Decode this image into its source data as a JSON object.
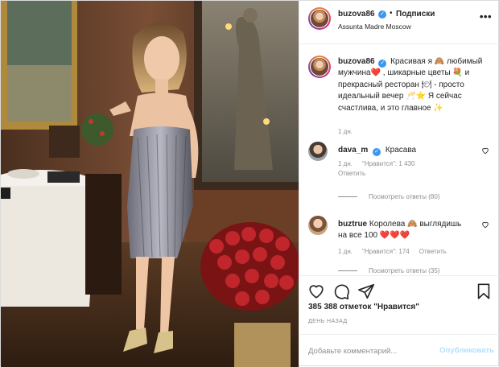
{
  "header": {
    "username": "buzova86",
    "separator": "•",
    "follow_label": "Подписки",
    "location": "Assunta Madre Moscow",
    "more": "•••"
  },
  "caption": {
    "username": "buzova86",
    "text": "Красивая я 🙈 любимый мужчина❤️ , шикарные цветы 💐 и прекрасный ресторан 🍽 - просто идеальный вечер 🥂⭐ Я сейчас счастлива, и это главное ✨",
    "time": "1 дн."
  },
  "comments": [
    {
      "username": "dava_m",
      "text": "Красава",
      "time": "1 дн.",
      "likes": "\"Нравится\": 1 430",
      "reply": "Ответить",
      "view_replies": "Посмотреть ответы (80)"
    },
    {
      "username": "buztrue",
      "text": "Королева 🙈 выглядишь на все 100 ❤️❤️❤️",
      "time": "1 дн.",
      "likes": "\"Нравится\": 174",
      "reply": "Ответить",
      "view_replies": "Посмотреть ответы (35)"
    }
  ],
  "likes": {
    "count_text": "385 388 отметок \"Нравится\""
  },
  "date": "ДЕНЬ НАЗАД",
  "add_comment": {
    "placeholder": "Добавьте комментарий...",
    "publish_label": "Опубликовать"
  },
  "colors": {
    "verified": "#3897f0",
    "heart_red": "#ed4956",
    "publish_disabled": "#b2dffc",
    "secondary_text": "#8e8e8e"
  },
  "icons": {
    "like": "heart-icon",
    "comment": "comment-icon",
    "share": "share-icon",
    "save": "bookmark-icon",
    "verified": "verified-badge-icon",
    "more": "more-options-icon"
  }
}
